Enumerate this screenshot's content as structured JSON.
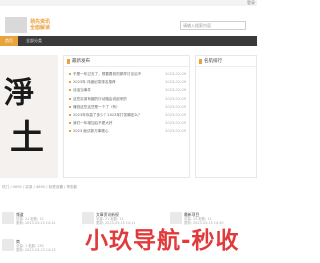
{
  "topbar": {
    "login": "登录"
  },
  "header": {
    "logo_line1": "领先资讯",
    "logo_line2": "全面解读",
    "search_placeholder": "请输入搜索内容"
  },
  "nav": {
    "items": [
      {
        "label": "首页",
        "active": true
      },
      {
        "label": "全部分类",
        "active": false
      }
    ]
  },
  "banner": {
    "calligraphy": "淨土"
  },
  "latest": {
    "title": "最新发布",
    "items": [
      {
        "text": "不是一年过去了，想要看到的那样讨论后不",
        "date": "2023-02-09"
      },
      {
        "text": "2023年 详细纪录排名推荐",
        "date": "2023-02-09"
      },
      {
        "text": "谈话当事件",
        "date": "2023-02-09"
      },
      {
        "text": "这些实用有趣的行动路由说起来的",
        "date": "2023-02-09"
      },
      {
        "text": "赚钱这些这些是一个了（有）",
        "date": "2023-02-09"
      },
      {
        "text": "2023年你赢了多少？2023年打答确定么？",
        "date": "2023-02-09"
      },
      {
        "text": "我们一年增加后不更大好",
        "date": "2023-02-09"
      },
      {
        "text": "2023 面试新万事顺心",
        "date": "2023-02-09"
      }
    ]
  },
  "ranking": {
    "title": "名航排行"
  },
  "breadcrumb": "热门 / 4092 / 实录 / 4692 / 标签设置 / 李剪影",
  "cards": [
    {
      "name": "频道",
      "meta": "总量: 21  粘数: 12",
      "meta2": "更新: 2023-03-13 14:12"
    },
    {
      "name": "文章资讯新规",
      "meta": "总量: 21  粘数: 11",
      "meta2": "更新: 2023-03-13 14:11"
    },
    {
      "name": "最新项目",
      "meta": "总量: 23  粘数: 11",
      "meta2": "更新: 2023-03-13 14:30"
    },
    {
      "name": "商",
      "meta": "总量: 1  粘数: 135",
      "meta2": "更新: 2023-03-13 14:13"
    }
  ],
  "watermark": "小玖导航-秒收"
}
